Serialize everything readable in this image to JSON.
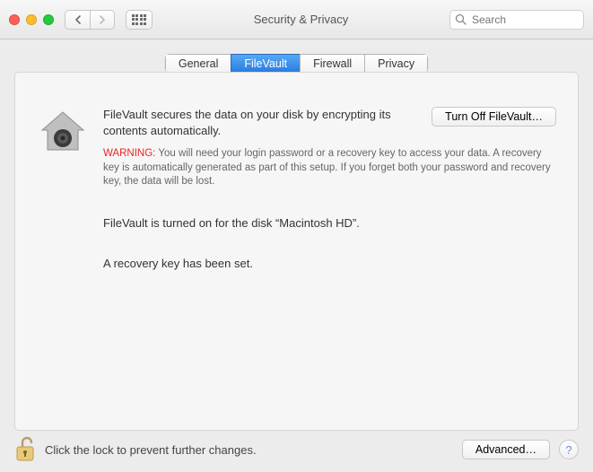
{
  "window": {
    "title": "Security & Privacy"
  },
  "search": {
    "placeholder": "Search"
  },
  "tabs": {
    "general": "General",
    "filevault": "FileVault",
    "firewall": "Firewall",
    "privacy": "Privacy"
  },
  "filevault": {
    "description": "FileVault secures the data on your disk by encrypting its contents automatically.",
    "turn_off_label": "Turn Off FileVault…",
    "warning_label": "WARNING:",
    "warning_text": " You will need your login password or a recovery key to access your data. A recovery key is automatically generated as part of this setup. If you forget both your password and recovery key, the data will be lost.",
    "status": "FileVault is turned on for the disk “Macintosh HD”.",
    "recovery": "A recovery key has been set."
  },
  "footer": {
    "lock_text": "Click the lock to prevent further changes.",
    "advanced_label": "Advanced…",
    "help_label": "?"
  }
}
